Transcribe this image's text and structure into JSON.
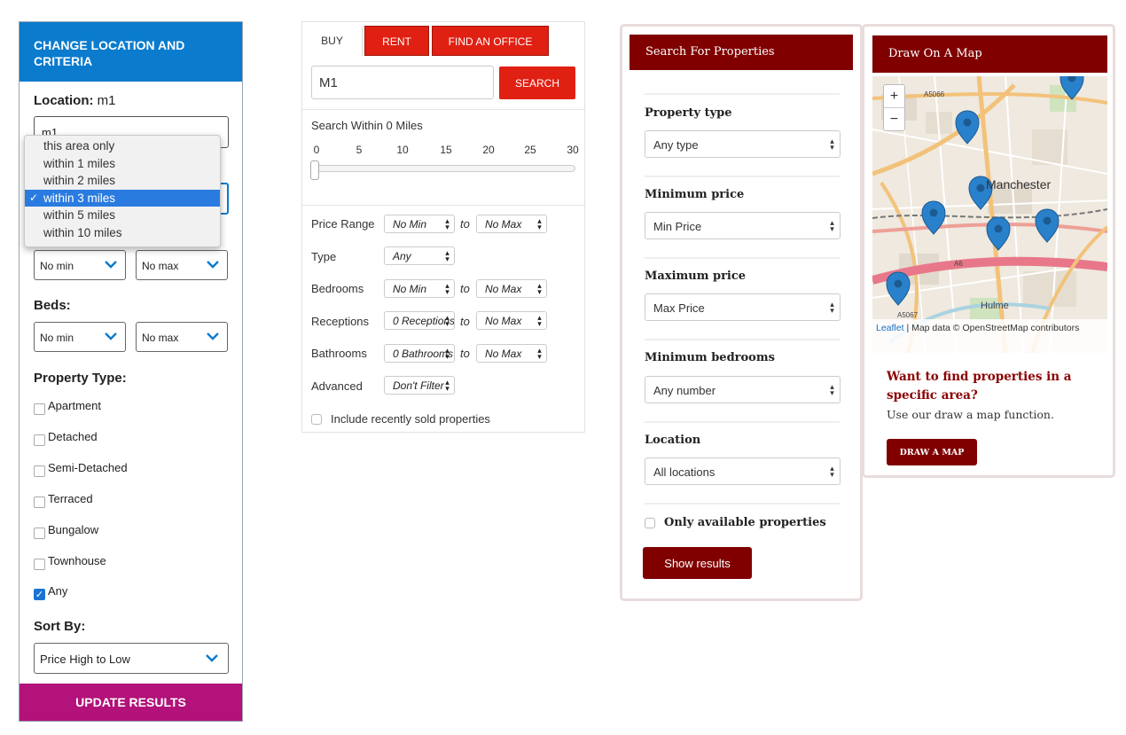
{
  "panel1": {
    "header": "CHANGE LOCATION AND CRITERIA",
    "location_label": "Location:",
    "location_value": "m1",
    "location_input": "m1",
    "radius_options": [
      "this area only",
      "within 1 miles",
      "within 2 miles",
      "within 3 miles",
      "within 5 miles",
      "within 10 miles"
    ],
    "radius_selected": "within 3 miles",
    "price_min": "No min",
    "price_max": "No max",
    "beds_label": "Beds:",
    "beds_min": "No min",
    "beds_max": "No max",
    "property_type_label": "Property Type:",
    "property_types": [
      {
        "label": "Apartment",
        "checked": false
      },
      {
        "label": "Detached",
        "checked": false
      },
      {
        "label": "Semi-Detached",
        "checked": false
      },
      {
        "label": "Terraced",
        "checked": false
      },
      {
        "label": "Bungalow",
        "checked": false
      },
      {
        "label": "Townhouse",
        "checked": false
      },
      {
        "label": "Any",
        "checked": true
      }
    ],
    "sort_label": "Sort By:",
    "sort_value": "Price High to Low",
    "update_button": "UPDATE RESULTS",
    "colors": {
      "header": "#0a7bcd",
      "update": "#b2127a"
    }
  },
  "panel2": {
    "tabs": [
      "BUY",
      "RENT",
      "FIND AN OFFICE"
    ],
    "active_tab": "BUY",
    "search_value": "M1",
    "search_button": "SEARCH",
    "within_label": "Search Within 0 Miles",
    "slider_ticks": [
      "0",
      "5",
      "10",
      "15",
      "20",
      "25",
      "30"
    ],
    "slider_value": 0,
    "to_label": "to",
    "rows": [
      {
        "label": "Price Range",
        "from": "No Min",
        "to": "No Max"
      },
      {
        "label": "Type",
        "from": "Any"
      },
      {
        "label": "Bedrooms",
        "from": "No Min",
        "to": "No Max"
      },
      {
        "label": "Receptions",
        "from": "0 Receptions",
        "to": "No Max"
      },
      {
        "label": "Bathrooms",
        "from": "0 Bathrooms",
        "to": "No Max"
      },
      {
        "label": "Advanced",
        "from": "Don't Filter"
      }
    ],
    "sold_label": "Include recently sold properties",
    "colors": {
      "accent": "#e02012"
    }
  },
  "panel3": {
    "header": "Search For Properties",
    "property_type_label": "Property type",
    "property_type_value": "Any type",
    "min_price_label": "Minimum price",
    "min_price_value": "Min Price",
    "max_price_label": "Maximum price",
    "max_price_value": "Max Price",
    "min_beds_label": "Minimum bedrooms",
    "min_beds_value": "Any number",
    "location_label": "Location",
    "location_value": "All locations",
    "available_label": "Only available properties",
    "show_button": "Show results",
    "colors": {
      "accent": "#800000"
    }
  },
  "panel4": {
    "header": "Draw On A Map",
    "map": {
      "zoom_in": "+",
      "zoom_out": "−",
      "city_label": "Manchester",
      "district_label": "Hulme",
      "road_labels": [
        "A5066",
        "A6",
        "A5067"
      ],
      "attribution_link": "Leaflet",
      "attribution_text": " | Map data © OpenStreetMap contributors"
    },
    "promo_title": "Want to find properties in a specific area?",
    "promo_text": "Use our draw a map function.",
    "draw_button": "DRAW A MAP",
    "colors": {
      "accent": "#800000",
      "marker": "#2a81cb"
    }
  }
}
